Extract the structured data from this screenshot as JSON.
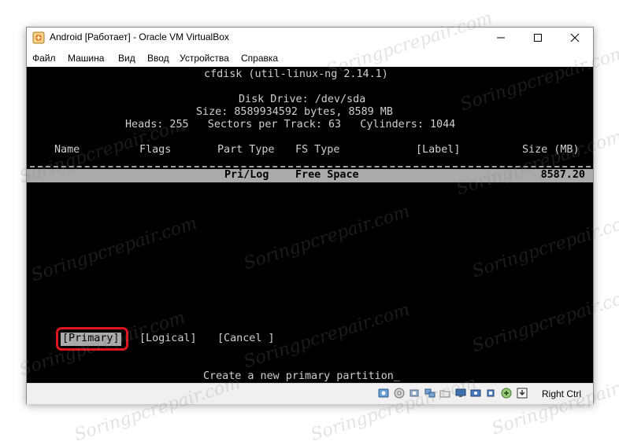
{
  "window": {
    "title": "Android [Работает] - Oracle VM VirtualBox",
    "minimize_glyph": "—",
    "maximize_glyph": "☐",
    "close_glyph": "✕"
  },
  "menu": [
    "Файл",
    "Машина",
    "Вид",
    "Ввод",
    "Устройства",
    "Справка"
  ],
  "terminal": {
    "header": "cfdisk (util-linux-ng 2.14.1)",
    "disk_drive": "Disk Drive: /dev/sda",
    "size": "Size: 8589934592 bytes, 8589 MB",
    "geometry": "Heads: 255   Sectors per Track: 63   Cylinders: 1044",
    "columns": {
      "name": "Name",
      "flags": "Flags",
      "part_type": "Part Type",
      "fs_type": "FS Type",
      "label": "[Label]",
      "size": "Size (MB)"
    },
    "row": {
      "part_type": "Pri/Log",
      "fs_type": "Free Space",
      "size": "8587.20"
    },
    "options": {
      "primary": "[Primary]",
      "logical": "[Logical]",
      "cancel": "[Cancel ]"
    },
    "prompt": "Create a new primary partition",
    "cursor": "_"
  },
  "statusbar": {
    "host_key": "Right Ctrl",
    "icons": [
      "hard-disk-icon",
      "optical-drive-icon",
      "audio-icon",
      "network-icon",
      "shared-folder-icon",
      "display-icon",
      "video-capture-icon",
      "cpu-icon",
      "usb-icon",
      "mouse-integration-icon"
    ]
  },
  "watermark": "Soringpcrepair.com",
  "colors": {
    "terminal_bg": "#000000",
    "terminal_fg": "#d0d0d0",
    "selection_bg": "#aaaaaa",
    "highlight_ring": "#e0141e"
  }
}
